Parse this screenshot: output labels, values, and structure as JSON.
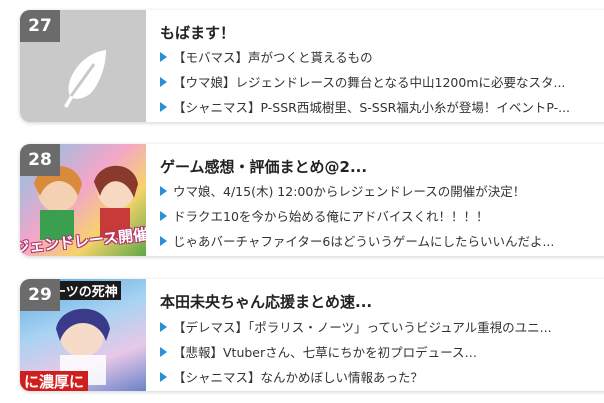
{
  "entries": [
    {
      "rank": "27",
      "site": "もばます！",
      "articles": [
        "【モバマス】声がつくと貰えるもの",
        "【ウマ娘】レジェンドレースの舞台となる中山1200mに必要なスタ...",
        "【シャニマス】P-SSR西城樹里、S-SSR福丸小糸が登場！イベントP-..."
      ],
      "thumb_icon": "feather-icon"
    },
    {
      "rank": "28",
      "site": "ゲーム感想・評価まとめ@2...",
      "articles": [
        "ウマ娘、4/15(木) 12:00からレジェンドレースの開催が決定！",
        "ドラクエ10を今から始める俺にアドバイスくれ！！！！",
        "じゃあバーチャファイター6はどういうゲームにしたらいいんだよ..."
      ],
      "thumb_text": "ジェンドレース開催"
    },
    {
      "rank": "29",
      "site": "本田未央ちゃん応援まとめ速...",
      "articles": [
        "【デレマス】「ポラリス・ノーツ」っていうビジュアル重視のユニ...",
        "【悲報】Vtuberさん、七草にちかを初プロデュース…",
        "【シャニマス】なんかめぼしい情報あった？"
      ],
      "thumb_text_top": "スノーツの死神",
      "thumb_text_bottom": "に濃厚に"
    }
  ],
  "colors": {
    "accent": "#2a8fd8",
    "rank_bg": "#6b6b6b",
    "placeholder_bg": "#c8c8c8"
  }
}
